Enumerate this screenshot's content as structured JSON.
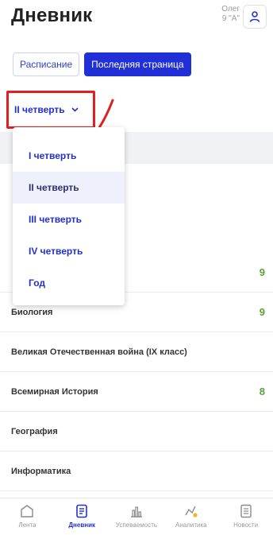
{
  "header": {
    "title": "Дневник",
    "user_name": "Олег",
    "user_class": "9 \"А\"",
    "avatar_icon": "user-icon"
  },
  "tabs": [
    {
      "label": "Расписание",
      "active": false
    },
    {
      "label": "Последняя страница",
      "active": true
    }
  ],
  "quarter_select": {
    "value": "II четверть",
    "icon": "chevron-down-icon"
  },
  "dropdown": {
    "options": [
      "I четверть",
      "II четверть",
      "III четверть",
      "IV четверть",
      "Год"
    ],
    "selected_index": 1
  },
  "subjects": [
    {
      "name": "",
      "grade": "9"
    },
    {
      "name": "Биология",
      "grade": "9"
    },
    {
      "name": "Великая Отечественная война (IX класс)",
      "grade": ""
    },
    {
      "name": "Всемирная История",
      "grade": "8"
    },
    {
      "name": "География",
      "grade": ""
    },
    {
      "name": "Информатика",
      "grade": ""
    }
  ],
  "bottom_nav": [
    {
      "label": "Лента",
      "icon": "home-icon",
      "active": false
    },
    {
      "label": "Дневник",
      "icon": "diary-icon",
      "active": true
    },
    {
      "label": "Успеваемость",
      "icon": "bar-chart-icon",
      "active": false
    },
    {
      "label": "Аналитика",
      "icon": "analytics-icon",
      "active": false
    },
    {
      "label": "Новости",
      "icon": "news-icon",
      "active": false
    }
  ],
  "colors": {
    "accent": "#2130d6",
    "grade_green": "#57a33b",
    "annotation_red": "#e02020"
  }
}
